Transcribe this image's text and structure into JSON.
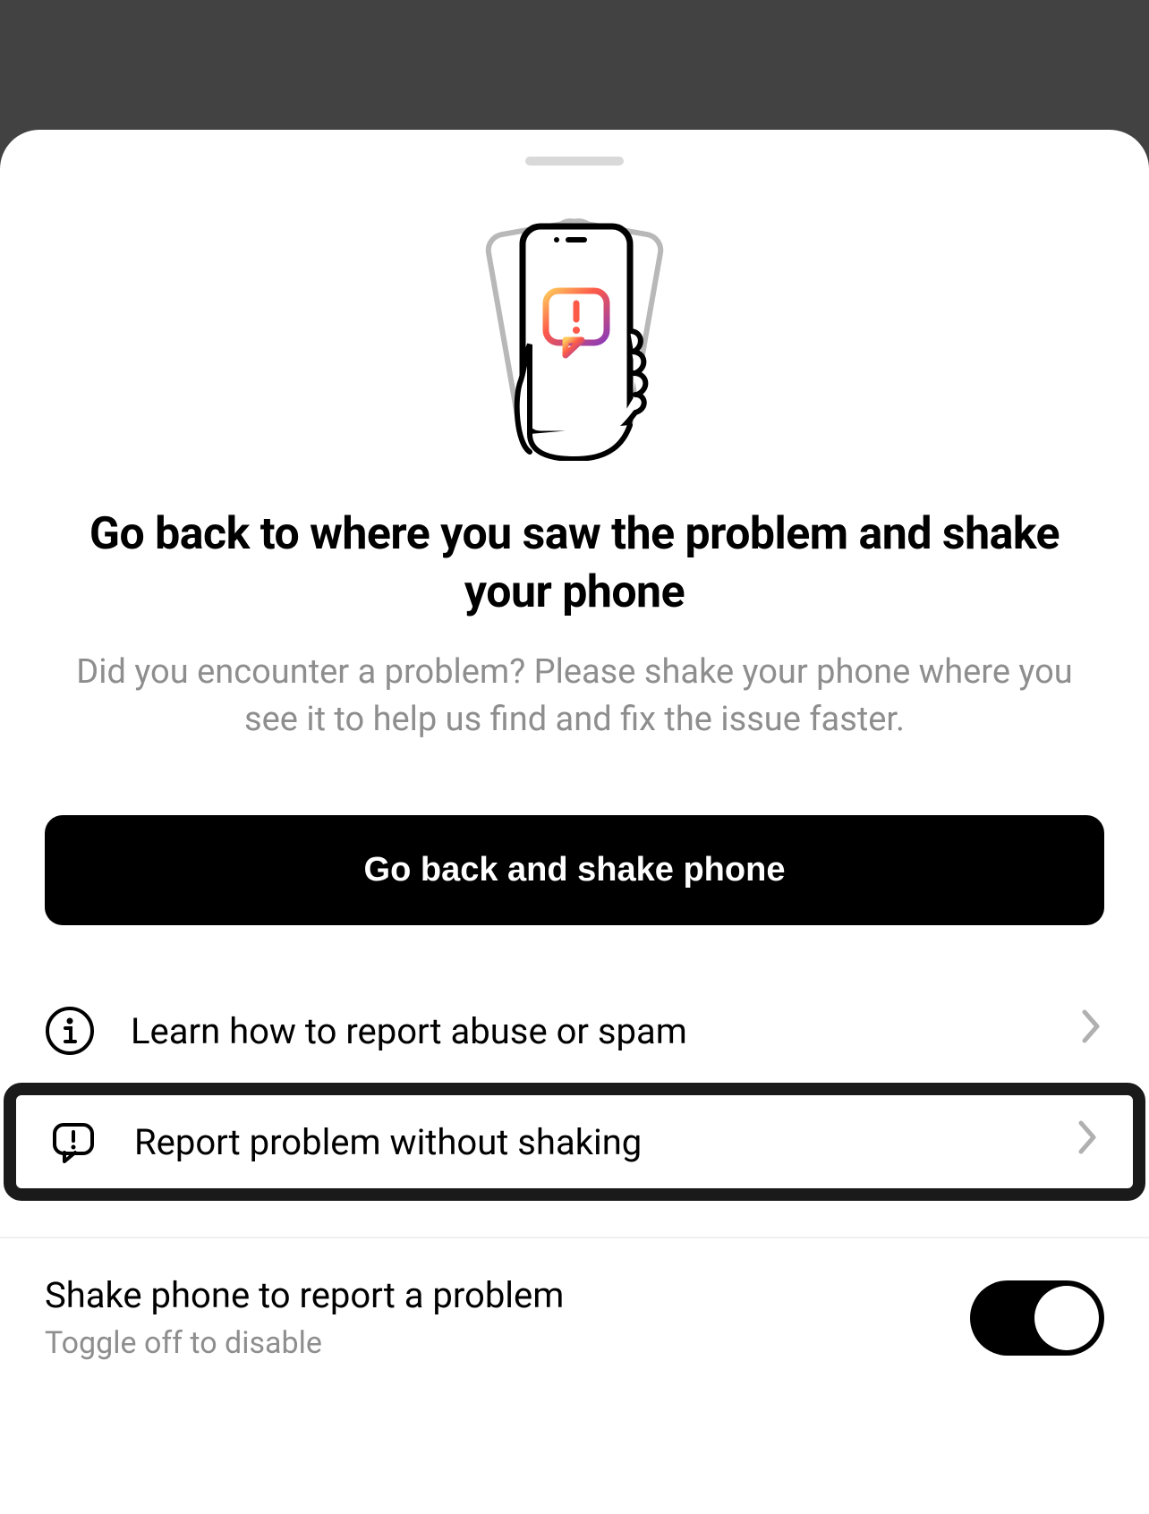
{
  "header": {
    "title": "Go back to where you saw the problem and shake your phone",
    "subtitle": "Did you encounter a problem? Please shake your phone where you see it to help us find and fix the issue faster."
  },
  "primary_button": {
    "label": "Go back and shake phone"
  },
  "rows": [
    {
      "icon": "info-icon",
      "label": "Learn how to report abuse or spam"
    },
    {
      "icon": "chat-alert-icon",
      "label": "Report problem without shaking"
    }
  ],
  "toggle": {
    "title": "Shake phone to report a problem",
    "subtitle": "Toggle off to disable",
    "enabled": true
  }
}
